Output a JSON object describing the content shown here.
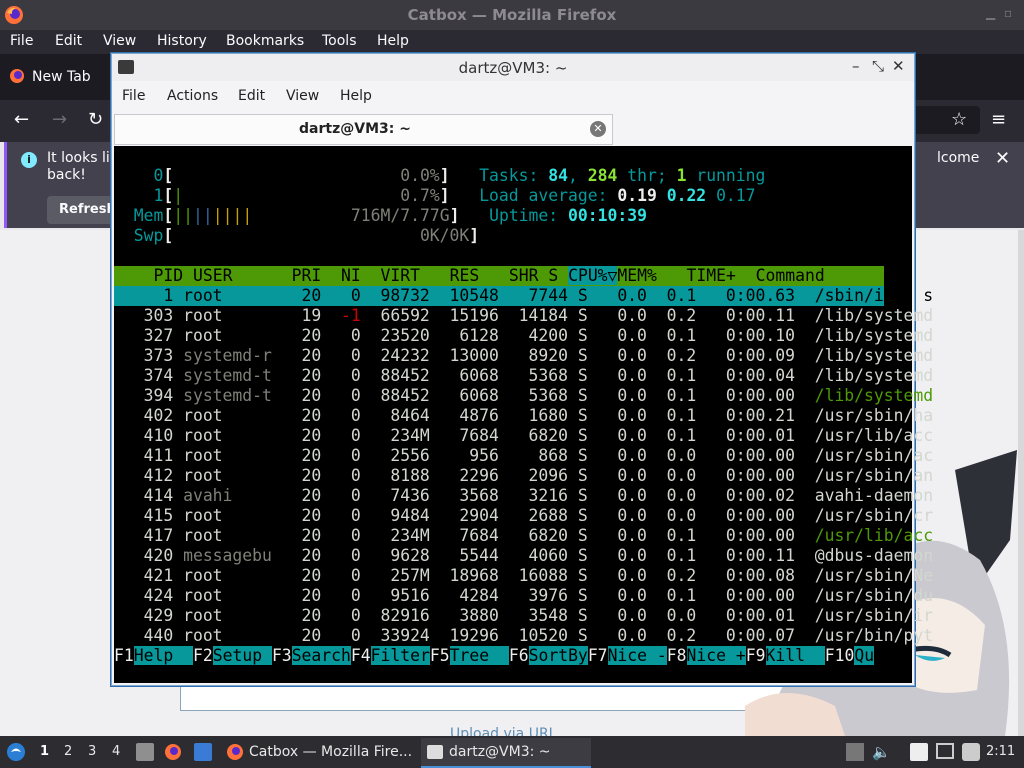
{
  "firefox": {
    "title": "Catbox — Mozilla Firefox",
    "menu": [
      "File",
      "Edit",
      "View",
      "History",
      "Bookmarks",
      "Tools",
      "Help"
    ],
    "tab_label": "New Tab",
    "notice_text_1": "It looks lik",
    "notice_text_2": "back!",
    "notice_text_3": "lcome",
    "refresh_label": "Refresh",
    "upload_url_text": "Upload via URL"
  },
  "terminal": {
    "title": "dartz@VM3: ~",
    "menu": [
      "File",
      "Actions",
      "Edit",
      "View",
      "Help"
    ],
    "tab_label": "dartz@VM3: ~"
  },
  "htop": {
    "cpu0": {
      "label": "0",
      "value": "0.0%"
    },
    "cpu1": {
      "label": "1",
      "value": "0.7%"
    },
    "mem": {
      "label": "Mem",
      "value": "716M/7.77G"
    },
    "swp": {
      "label": "Swp",
      "value": "0K/0K"
    },
    "tasks": {
      "label": "Tasks: ",
      "count": "84",
      "threads": "284",
      "thr_label": " thr; ",
      "running": "1",
      "running_label": " running"
    },
    "load": {
      "label": "Load average: ",
      "l1": "0.19",
      "l5": "0.22",
      "l15": "0.17"
    },
    "uptime": {
      "label": "Uptime: ",
      "value": "00:10:39"
    },
    "columns": [
      "PID",
      "USER",
      "PRI",
      "NI",
      "VIRT",
      "RES",
      "SHR",
      "S",
      "CPU%▽",
      "MEM%",
      "TIME+",
      "Command"
    ],
    "processes": [
      {
        "pid": "1",
        "user": "root",
        "pri": "20",
        "ni": "0",
        "virt": "98732",
        "res": "10548",
        "shr": "7744",
        "s": "S",
        "cpu": "0.0",
        "mem": "0.1",
        "time": "0:00.63",
        "cmd": "/sbin/init s"
      },
      {
        "pid": "303",
        "user": "root",
        "pri": "19",
        "ni": "-1",
        "virt": "66592",
        "res": "15196",
        "shr": "14184",
        "s": "S",
        "cpu": "0.0",
        "mem": "0.2",
        "time": "0:00.11",
        "cmd": "/lib/systemd"
      },
      {
        "pid": "327",
        "user": "root",
        "pri": "20",
        "ni": "0",
        "virt": "23520",
        "res": "6128",
        "shr": "4200",
        "s": "S",
        "cpu": "0.0",
        "mem": "0.1",
        "time": "0:00.10",
        "cmd": "/lib/systemd"
      },
      {
        "pid": "373",
        "user": "systemd-r",
        "pri": "20",
        "ni": "0",
        "virt": "24232",
        "res": "13000",
        "shr": "8920",
        "s": "S",
        "cpu": "0.0",
        "mem": "0.2",
        "time": "0:00.09",
        "cmd": "/lib/systemd"
      },
      {
        "pid": "374",
        "user": "systemd-t",
        "pri": "20",
        "ni": "0",
        "virt": "88452",
        "res": "6068",
        "shr": "5368",
        "s": "S",
        "cpu": "0.0",
        "mem": "0.1",
        "time": "0:00.04",
        "cmd": "/lib/systemd"
      },
      {
        "pid": "394",
        "user": "systemd-t",
        "pri": "20",
        "ni": "0",
        "virt": "88452",
        "res": "6068",
        "shr": "5368",
        "s": "S",
        "cpu": "0.0",
        "mem": "0.1",
        "time": "0:00.00",
        "cmd": "/lib/systemd"
      },
      {
        "pid": "402",
        "user": "root",
        "pri": "20",
        "ni": "0",
        "virt": "8464",
        "res": "4876",
        "shr": "1680",
        "s": "S",
        "cpu": "0.0",
        "mem": "0.1",
        "time": "0:00.21",
        "cmd": "/usr/sbin/ha"
      },
      {
        "pid": "410",
        "user": "root",
        "pri": "20",
        "ni": "0",
        "virt": "234M",
        "res": "7684",
        "shr": "6820",
        "s": "S",
        "cpu": "0.0",
        "mem": "0.1",
        "time": "0:00.01",
        "cmd": "/usr/lib/acc"
      },
      {
        "pid": "411",
        "user": "root",
        "pri": "20",
        "ni": "0",
        "virt": "2556",
        "res": "956",
        "shr": "868",
        "s": "S",
        "cpu": "0.0",
        "mem": "0.0",
        "time": "0:00.00",
        "cmd": "/usr/sbin/ac"
      },
      {
        "pid": "412",
        "user": "root",
        "pri": "20",
        "ni": "0",
        "virt": "8188",
        "res": "2296",
        "shr": "2096",
        "s": "S",
        "cpu": "0.0",
        "mem": "0.0",
        "time": "0:00.00",
        "cmd": "/usr/sbin/an"
      },
      {
        "pid": "414",
        "user": "avahi",
        "pri": "20",
        "ni": "0",
        "virt": "7436",
        "res": "3568",
        "shr": "3216",
        "s": "S",
        "cpu": "0.0",
        "mem": "0.0",
        "time": "0:00.02",
        "cmd": "avahi-daemon"
      },
      {
        "pid": "415",
        "user": "root",
        "pri": "20",
        "ni": "0",
        "virt": "9484",
        "res": "2904",
        "shr": "2688",
        "s": "S",
        "cpu": "0.0",
        "mem": "0.0",
        "time": "0:00.00",
        "cmd": "/usr/sbin/cr"
      },
      {
        "pid": "417",
        "user": "root",
        "pri": "20",
        "ni": "0",
        "virt": "234M",
        "res": "7684",
        "shr": "6820",
        "s": "S",
        "cpu": "0.0",
        "mem": "0.1",
        "time": "0:00.00",
        "cmd": "/usr/lib/acc"
      },
      {
        "pid": "420",
        "user": "messagebu",
        "pri": "20",
        "ni": "0",
        "virt": "9628",
        "res": "5544",
        "shr": "4060",
        "s": "S",
        "cpu": "0.0",
        "mem": "0.1",
        "time": "0:00.11",
        "cmd": "@dbus-daemon"
      },
      {
        "pid": "421",
        "user": "root",
        "pri": "20",
        "ni": "0",
        "virt": "257M",
        "res": "18968",
        "shr": "16088",
        "s": "S",
        "cpu": "0.0",
        "mem": "0.2",
        "time": "0:00.08",
        "cmd": "/usr/sbin/Ne"
      },
      {
        "pid": "424",
        "user": "root",
        "pri": "20",
        "ni": "0",
        "virt": "9516",
        "res": "4284",
        "shr": "3976",
        "s": "S",
        "cpu": "0.0",
        "mem": "0.1",
        "time": "0:00.00",
        "cmd": "/usr/sbin/du"
      },
      {
        "pid": "429",
        "user": "root",
        "pri": "20",
        "ni": "0",
        "virt": "82916",
        "res": "3880",
        "shr": "3548",
        "s": "S",
        "cpu": "0.0",
        "mem": "0.0",
        "time": "0:00.01",
        "cmd": "/usr/sbin/ir"
      },
      {
        "pid": "440",
        "user": "root",
        "pri": "20",
        "ni": "0",
        "virt": "33924",
        "res": "19296",
        "shr": "10520",
        "s": "S",
        "cpu": "0.0",
        "mem": "0.2",
        "time": "0:00.07",
        "cmd": "/usr/bin/pyt"
      }
    ],
    "fkeys": [
      {
        "key": "F1",
        "label": "Help  "
      },
      {
        "key": "F2",
        "label": "Setup "
      },
      {
        "key": "F3",
        "label": "Search"
      },
      {
        "key": "F4",
        "label": "Filter"
      },
      {
        "key": "F5",
        "label": "Tree  "
      },
      {
        "key": "F6",
        "label": "SortBy"
      },
      {
        "key": "F7",
        "label": "Nice -"
      },
      {
        "key": "F8",
        "label": "Nice +"
      },
      {
        "key": "F9",
        "label": "Kill  "
      },
      {
        "key": "F10",
        "label": "Qu"
      }
    ]
  },
  "taskbar": {
    "workspaces": [
      "1",
      "2",
      "3",
      "4"
    ],
    "firefox_task": "Catbox — Mozilla Fire...",
    "terminal_task": "dartz@VM3: ~",
    "clock": "2:11"
  }
}
